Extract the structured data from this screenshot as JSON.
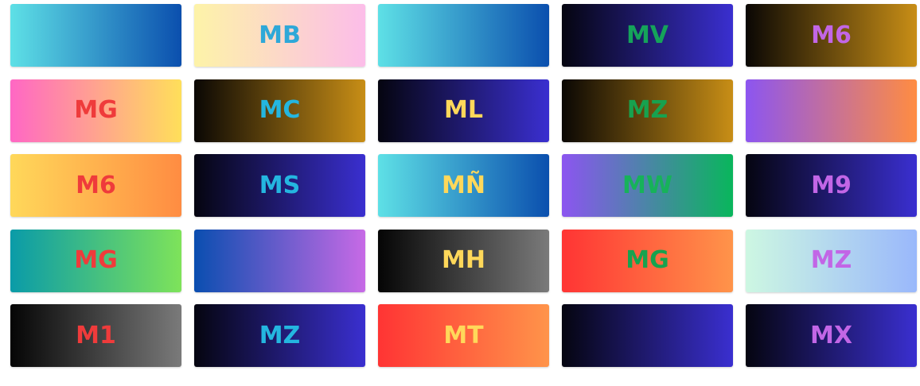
{
  "tiles": [
    {
      "label": "",
      "color": "#6fd3f5",
      "from": "#5ee0e6",
      "to": "#0b4fae"
    },
    {
      "label": "MB",
      "color": "#2ea8d8",
      "from": "#fdf3a8",
      "to": "#fcbde9"
    },
    {
      "label": "",
      "color": "#6fd3f5",
      "from": "#5ee0e6",
      "to": "#0b4fae"
    },
    {
      "label": "MV",
      "color": "#15a35a",
      "from": "#050510",
      "to": "#3a2fd0"
    },
    {
      "label": "M6",
      "color": "#c266e6",
      "from": "#0a0704",
      "to": "#c88e16"
    },
    {
      "label": "MG",
      "color": "#ef3b3b",
      "from": "#ff67c4",
      "to": "#ffdf5a"
    },
    {
      "label": "MC",
      "color": "#24b6e0",
      "from": "#0a0704",
      "to": "#c88e16"
    },
    {
      "label": "ML",
      "color": "#ffd85a",
      "from": "#050510",
      "to": "#3a2fd0"
    },
    {
      "label": "MZ",
      "color": "#17a24f",
      "from": "#0a0704",
      "to": "#c88e16"
    },
    {
      "label": "",
      "color": "#c266e6",
      "from": "#8c55f0",
      "to": "#ff8c42"
    },
    {
      "label": "M6",
      "color": "#ef3b3b",
      "from": "#ffd85a",
      "to": "#ff8c42"
    },
    {
      "label": "MS",
      "color": "#24b6e0",
      "from": "#050510",
      "to": "#3a2fd0"
    },
    {
      "label": "MÑ",
      "color": "#ffd85a",
      "from": "#5ee0e6",
      "to": "#0b4fae"
    },
    {
      "label": "MW",
      "color": "#17b25a",
      "from": "#8c55f0",
      "to": "#09b65c"
    },
    {
      "label": "M9",
      "color": "#c266e6",
      "from": "#050510",
      "to": "#3a2fd0"
    },
    {
      "label": "MG",
      "color": "#ef3b3b",
      "from": "#0a9ba8",
      "to": "#7ee35a"
    },
    {
      "label": "",
      "color": "#c266e6",
      "from": "#0a4eb0",
      "to": "#c76ae6"
    },
    {
      "label": "MH",
      "color": "#ffd85a",
      "from": "#050505",
      "to": "#7a7a7a"
    },
    {
      "label": "MG",
      "color": "#17a24f",
      "from": "#ff3434",
      "to": "#ff944a"
    },
    {
      "label": "MZ",
      "color": "#c266e6",
      "from": "#cdf7e2",
      "to": "#9ab8fb"
    },
    {
      "label": "M1",
      "color": "#ef3b3b",
      "from": "#050505",
      "to": "#7a7a7a"
    },
    {
      "label": "MZ",
      "color": "#24b6e0",
      "from": "#050510",
      "to": "#3a2fd0"
    },
    {
      "label": "MT",
      "color": "#ffd85a",
      "from": "#ff3434",
      "to": "#ff944a"
    },
    {
      "label": "",
      "color": "#c266e6",
      "from": "#050510",
      "to": "#3a2fd0"
    },
    {
      "label": "MX",
      "color": "#c266e6",
      "from": "#050510",
      "to": "#3a2fd0"
    }
  ]
}
